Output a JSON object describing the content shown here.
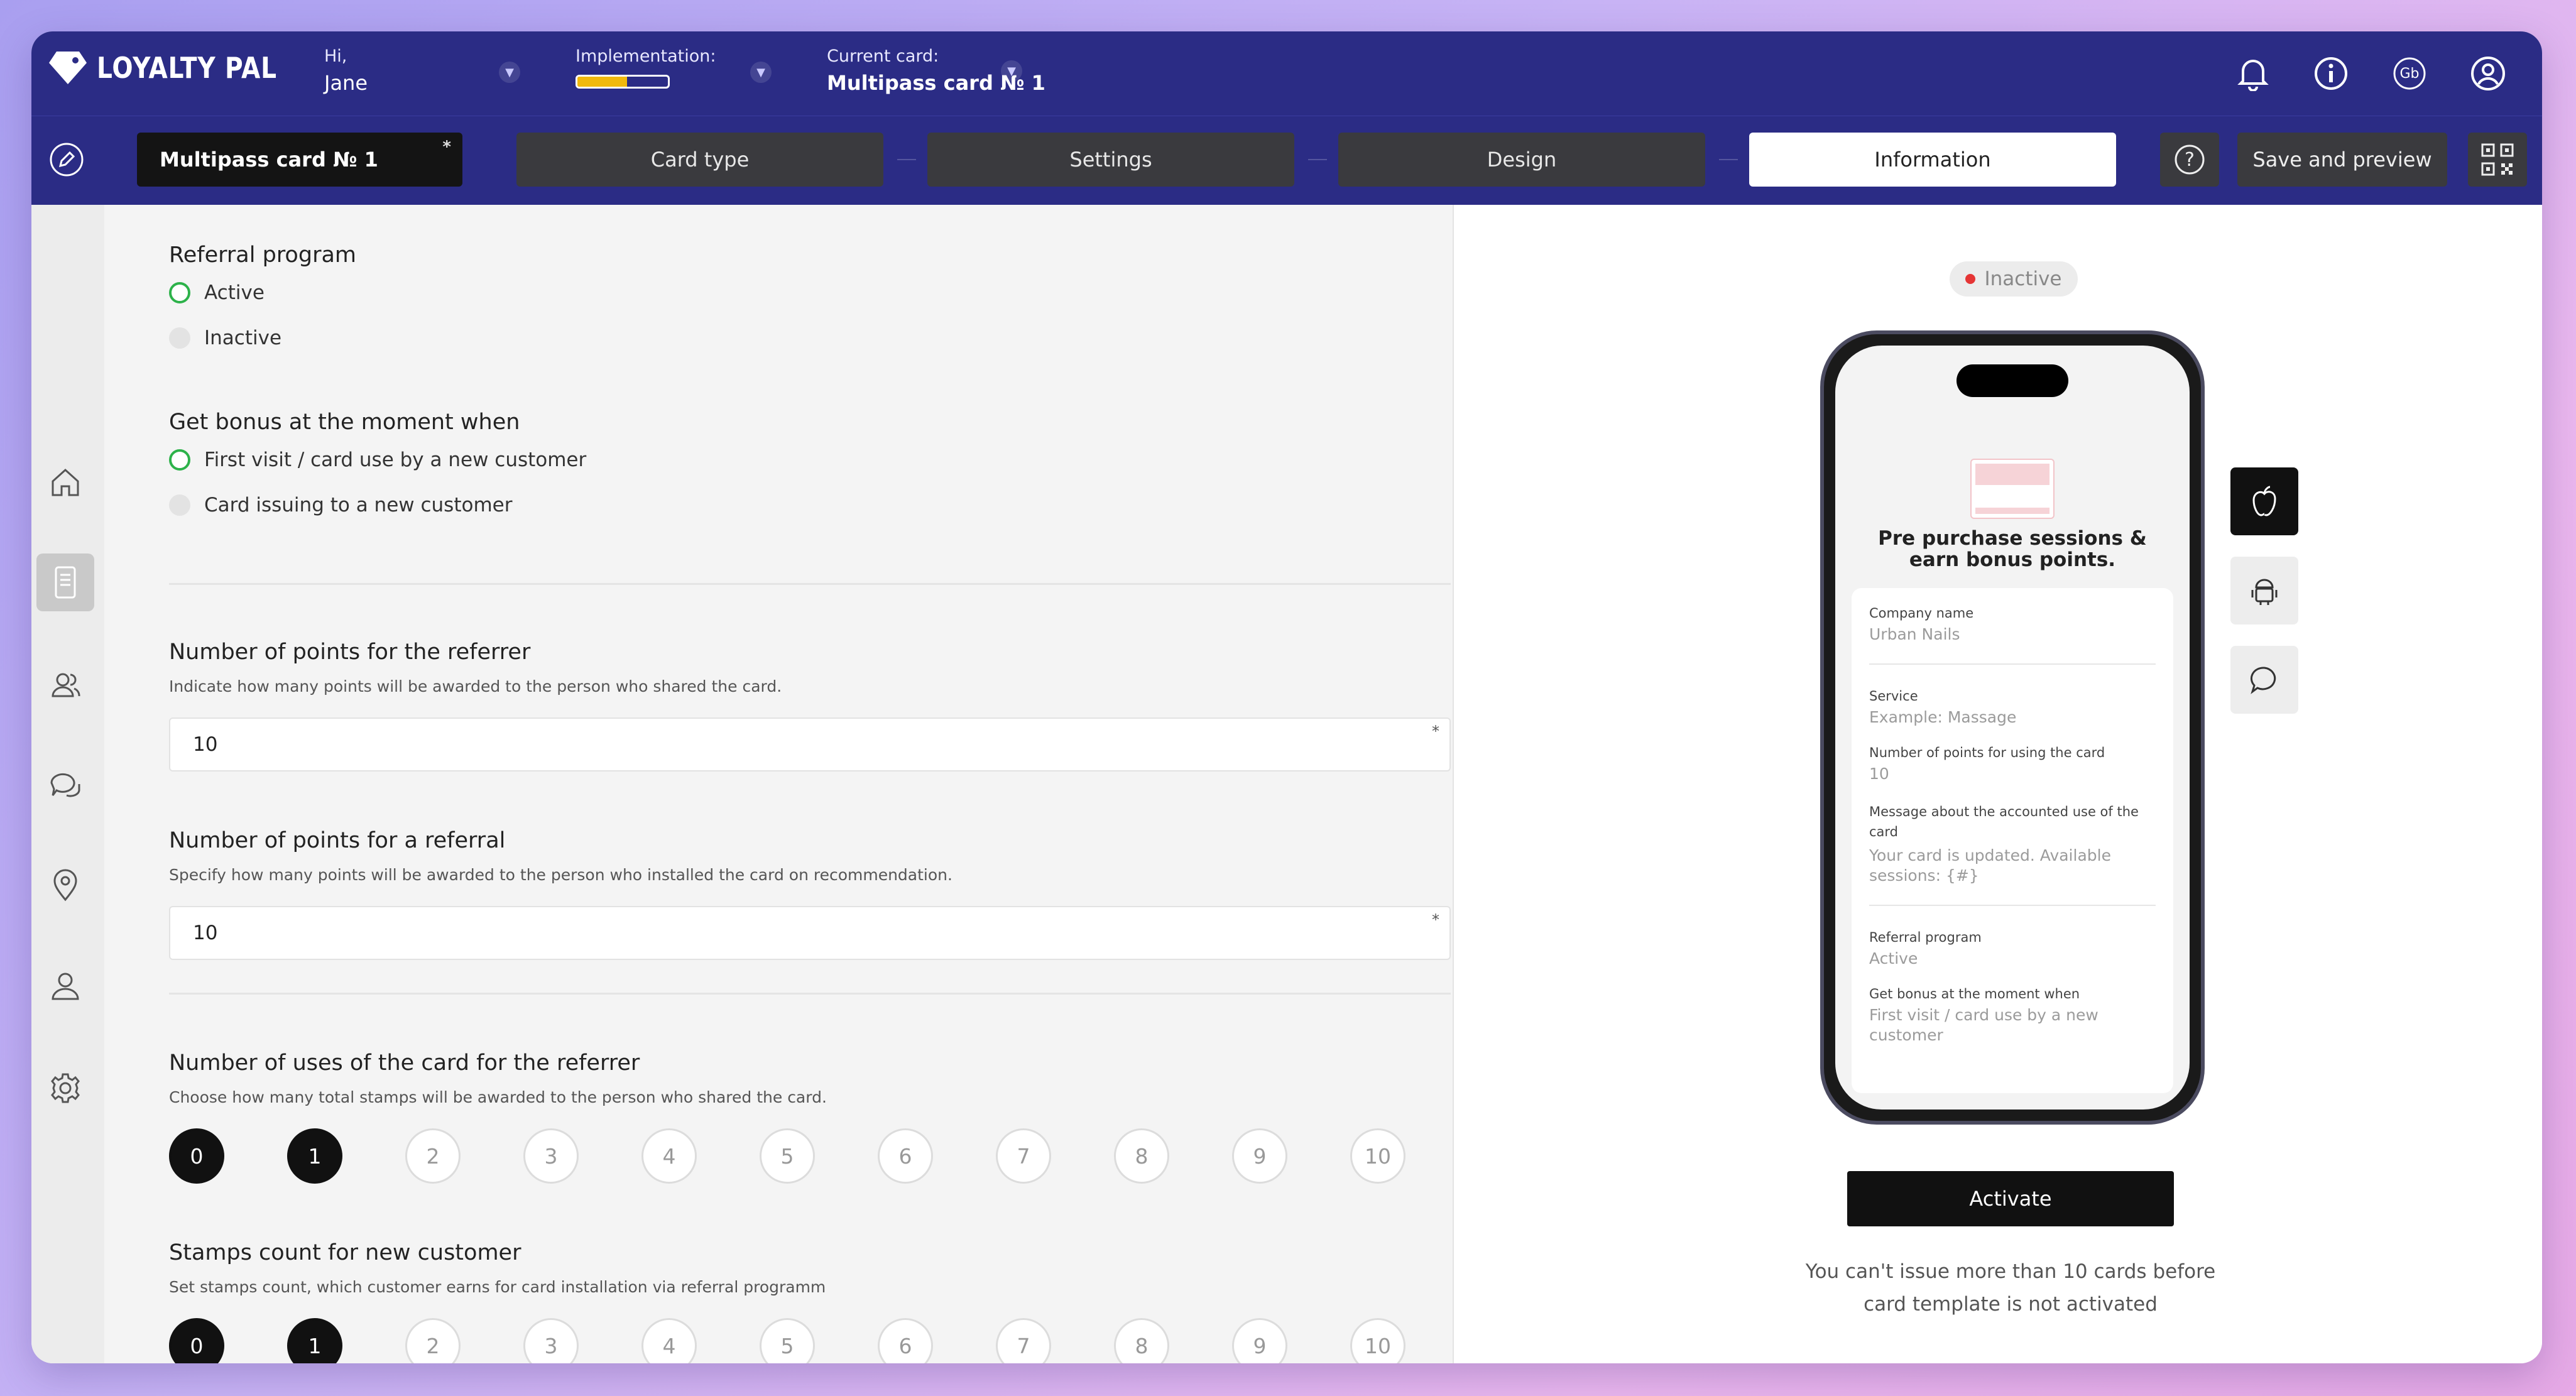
{
  "header": {
    "logo": "LOYALTY PAL",
    "greeting_label": "Hi,",
    "user_name": "Jane",
    "implementation_label": "Implementation:",
    "implementation_progress": 0.55,
    "current_card_label": "Current card:",
    "current_card_value": "Multipass card № 1",
    "language_icon_text": "Gb"
  },
  "toolbar": {
    "card_name": "Multipass card № 1",
    "required_mark": "*",
    "steps": [
      "Card type",
      "Settings",
      "Design",
      "Information"
    ],
    "active_step": "Information",
    "help_icon": "?",
    "save_label": "Save and preview"
  },
  "form": {
    "referral": {
      "title": "Referral program",
      "options": [
        "Active",
        "Inactive"
      ],
      "selected": "Active"
    },
    "bonus_moment": {
      "title": "Get bonus at the moment when",
      "options": [
        "First visit / card use by a new customer",
        "Card issuing to a new customer"
      ],
      "selected": "First visit / card use by a new customer"
    },
    "referrer_points": {
      "title": "Number of points for the referrer",
      "desc": "Indicate how many points will be awarded to the person who shared the card.",
      "value": "10",
      "required": "*"
    },
    "referral_points": {
      "title": "Number of points for a referral",
      "desc": "Specify how many points will be awarded to the person who installed the card on recommendation.",
      "value": "10",
      "required": "*"
    },
    "referrer_uses": {
      "title": "Number of uses of the card for the referrer",
      "desc": "Choose how many total stamps will be awarded to the person who shared the card.",
      "options": [
        "0",
        "1",
        "2",
        "3",
        "4",
        "5",
        "6",
        "7",
        "8",
        "9",
        "10"
      ],
      "selected": [
        "0",
        "1"
      ]
    },
    "new_customer_stamps": {
      "title": "Stamps count for new customer",
      "desc": "Set stamps count, which customer earns for card installation via referral programm",
      "options": [
        "0",
        "1",
        "2",
        "3",
        "4",
        "5",
        "6",
        "7",
        "8",
        "9",
        "10"
      ],
      "selected": [
        "0",
        "1"
      ]
    }
  },
  "preview": {
    "status": "Inactive",
    "title": "Pre purchase sessions & earn bonus points.",
    "fields": [
      {
        "label": "Company name",
        "value": "Urban Nails"
      },
      {
        "label": "Service",
        "value": "Example: Massage"
      },
      {
        "label": "Number of points for using the card",
        "value": "10"
      },
      {
        "label": "Message about the accounted use of the card",
        "value": "Your card is updated. Available sessions: {#}"
      },
      {
        "label": "Referral program",
        "value": "Active"
      },
      {
        "label": "Get bonus at the moment when",
        "value": "First visit / card use by a new customer"
      }
    ],
    "activate_label": "Activate",
    "note": "You can't issue more than 10 cards before card template is not activated"
  },
  "colors": {
    "header_bg": "#2b2c85",
    "accent_green": "#2db24a",
    "progress_yellow": "#f2b90d",
    "inactive_red": "#e53535"
  }
}
